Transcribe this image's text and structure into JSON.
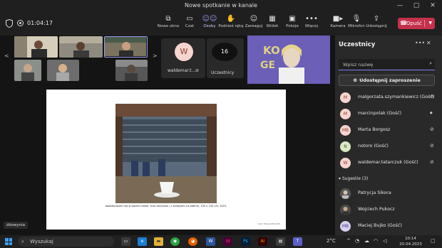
{
  "window": {
    "title": "Nowe spotkanie w kanale",
    "minimize_icon": "minimize-icon",
    "maximize_icon": "maximize-icon",
    "close_icon": "close-icon"
  },
  "toolbar": {
    "timer": "01:04:17",
    "buttons": [
      {
        "label": "Nowe okno",
        "icon": "new-window-icon"
      },
      {
        "label": "Czat",
        "icon": "chat-icon"
      },
      {
        "label": "Osoby",
        "icon": "people-icon"
      },
      {
        "label": "Podnieś rękę",
        "icon": "raise-hand-icon"
      },
      {
        "label": "Zareaguj",
        "icon": "react-icon"
      },
      {
        "label": "Widok",
        "icon": "view-icon"
      },
      {
        "label": "Pokoje",
        "icon": "rooms-icon"
      },
      {
        "label": "Więcej",
        "icon": "more-icon"
      },
      {
        "label": "Kamera",
        "icon": "camera-icon"
      },
      {
        "label": "Mikrofon",
        "icon": "microphone-icon"
      },
      {
        "label": "Udostępnij",
        "icon": "share-icon"
      }
    ],
    "leave_label": "Opuść",
    "accent": "#c4314b"
  },
  "strip": {
    "tile_w_initial": "W",
    "tile_w_name": "waldemar.t...",
    "tile_count": "16",
    "tile_count_label": "Uczestnicy",
    "video_overlay_text": "KONKURS GENERATA"
  },
  "slide": {
    "caption": "dookoła/dzieci się w swoim czasie, kura akrylowa / z akrografu na płótnie, 130 x 130 cm, 2022.",
    "footnote": "Autor: Mariusz Bilik 2023"
  },
  "presenter_label": "dkowynia",
  "panel": {
    "title": "Uczestnicy",
    "search_placeholder": "Wpisz nazwę",
    "share_invite": "Udostępnij zaproszenie",
    "participants": [
      {
        "initials": "M",
        "name": "malgorzata.szymankiewicz (Gość)",
        "mic": "mic-off-icon",
        "bg": "#f6d4cf",
        "fg": "#8a3b2d"
      },
      {
        "initials": "M",
        "name": "marcinpolak (Gość)",
        "mic": "mic-on-icon",
        "bg": "#f6d4cf",
        "fg": "#8a3b2d"
      },
      {
        "initials": "MB",
        "name": "Marta Borgosz",
        "mic": "mic-off-icon",
        "bg": "#f6d4cf",
        "fg": "#8a3b2d"
      },
      {
        "initials": "N",
        "name": "notoro (Gość)",
        "mic": "mic-off-icon",
        "bg": "#dbe9c7",
        "fg": "#3f5a1f"
      },
      {
        "initials": "W",
        "name": "waldemar.tatarczuk (Gość)",
        "mic": "mic-off-icon",
        "bg": "#f6d4cf",
        "fg": "#8a3b2d"
      }
    ],
    "suggestions_label": "Sugestie (3)",
    "suggestions": [
      {
        "initials": "",
        "name": "Patrycja Sikora"
      },
      {
        "initials": "",
        "name": "Wojciech Pukocz"
      },
      {
        "initials": "MB",
        "name": "Maciej Bujko (Gość)"
      }
    ]
  },
  "taskbar": {
    "search_label": "Wyszukaj",
    "temperature": "2°C",
    "time": "10:14",
    "date": "20.04.2023"
  }
}
